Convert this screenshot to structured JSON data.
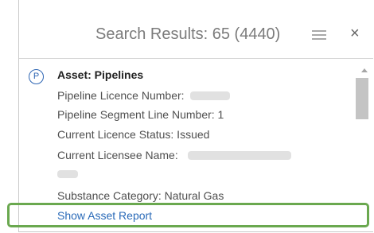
{
  "header": {
    "title": "Search Results: 65 (4440)",
    "close_glyph": "×"
  },
  "result": {
    "badge_letter": "P",
    "title": "Asset: Pipelines",
    "fields": [
      "Pipeline Licence Number:",
      "Pipeline Segment Line Number: 1",
      "Current Licence Status: Issued",
      "Current Licensee Name:",
      "Substance Category: Natural Gas"
    ],
    "link_label": "Show Asset Report"
  },
  "icons": {
    "list": "list-icon",
    "close": "close-icon",
    "badge": "pipeline-badge-icon"
  },
  "colors": {
    "link": "#2a6ab8",
    "badge": "#2d65b3",
    "highlight": "#6aa84f"
  }
}
